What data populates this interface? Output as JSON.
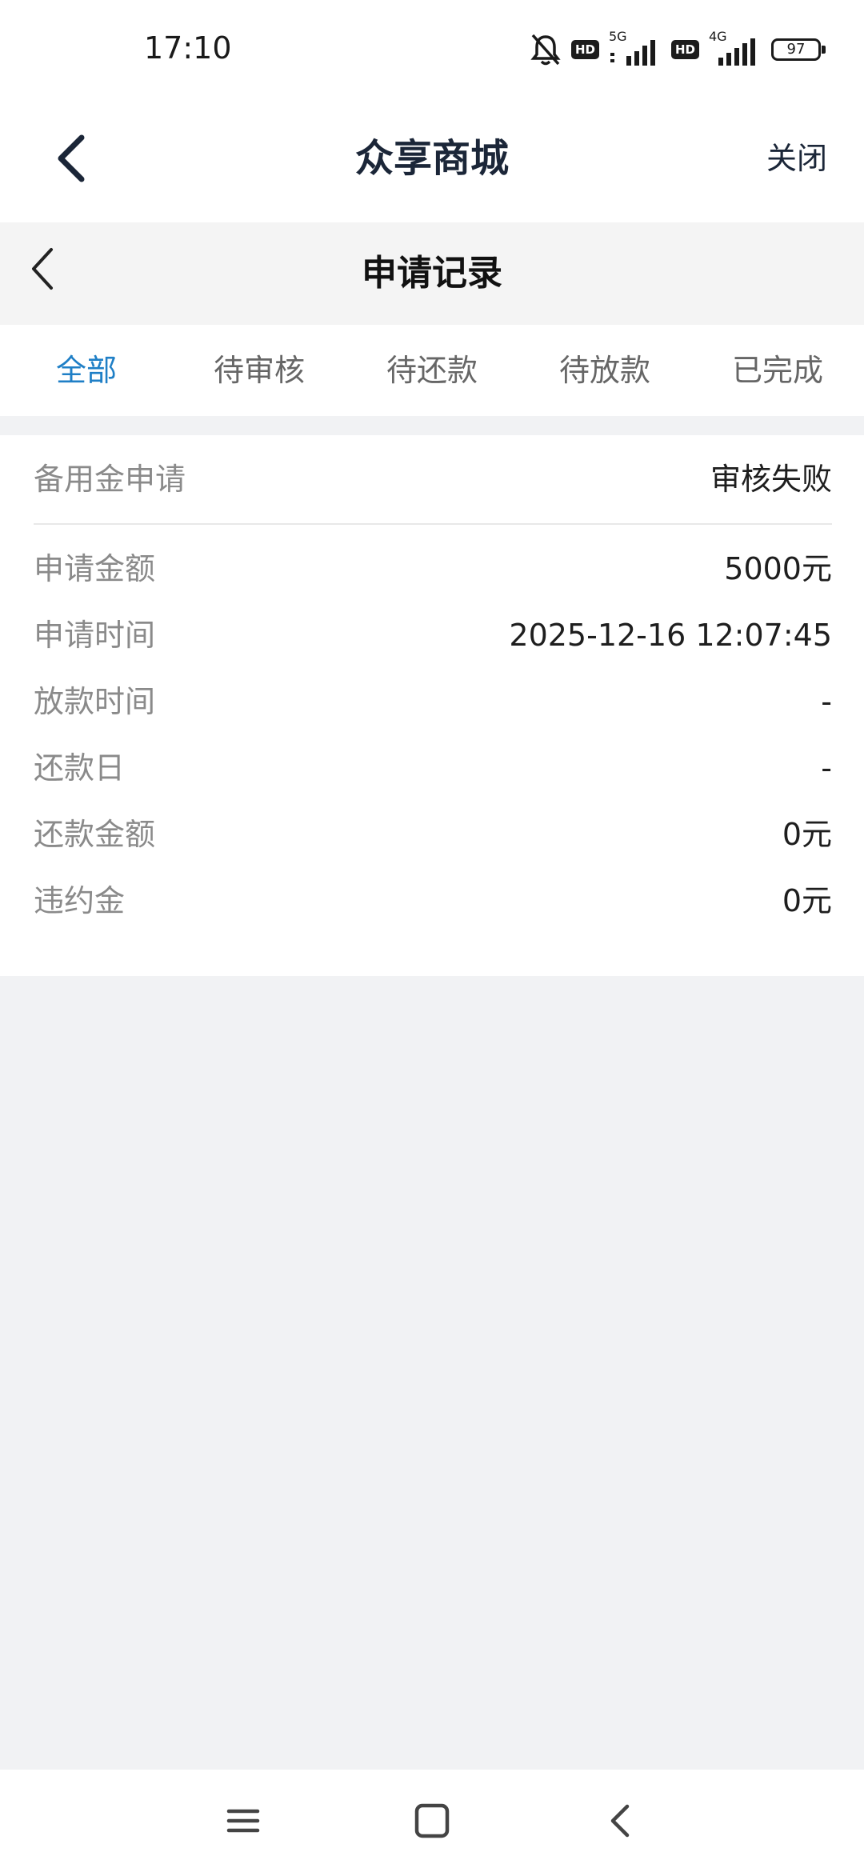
{
  "status_bar": {
    "time": "17:10",
    "icons": [
      "mute-bell-icon",
      "hd-badge",
      "signal-5g-icon",
      "hd-badge",
      "signal-4g-icon",
      "battery-icon"
    ],
    "hd_label": "HD",
    "net1_label": "5G",
    "net2_label": "4G",
    "battery_level": "97"
  },
  "app_header": {
    "title": "众享商城",
    "close_label": "关闭",
    "back_icon": "chevron-left-icon",
    "color": "#1b2638"
  },
  "sub_header": {
    "title": "申请记录",
    "back_icon": "chevron-left-icon"
  },
  "tabs": [
    {
      "label": "全部",
      "active": true
    },
    {
      "label": "待审核",
      "active": false
    },
    {
      "label": "待还款",
      "active": false
    },
    {
      "label": "待放款",
      "active": false
    },
    {
      "label": "已完成",
      "active": false
    }
  ],
  "accent_color": "#1f7fc6",
  "record": {
    "title": "备用金申请",
    "status": "审核失败",
    "rows": [
      {
        "label": "申请金额",
        "value": "5000元"
      },
      {
        "label": "申请时间",
        "value": "2025-12-16 12:07:45"
      },
      {
        "label": "放款时间",
        "value": "-"
      },
      {
        "label": "还款日",
        "value": "-"
      },
      {
        "label": "还款金额",
        "value": "0元"
      },
      {
        "label": "违约金",
        "value": "0元"
      }
    ]
  },
  "nav_bar": {
    "icons": [
      "menu-icon",
      "home-square-icon",
      "back-chevron-icon"
    ]
  }
}
